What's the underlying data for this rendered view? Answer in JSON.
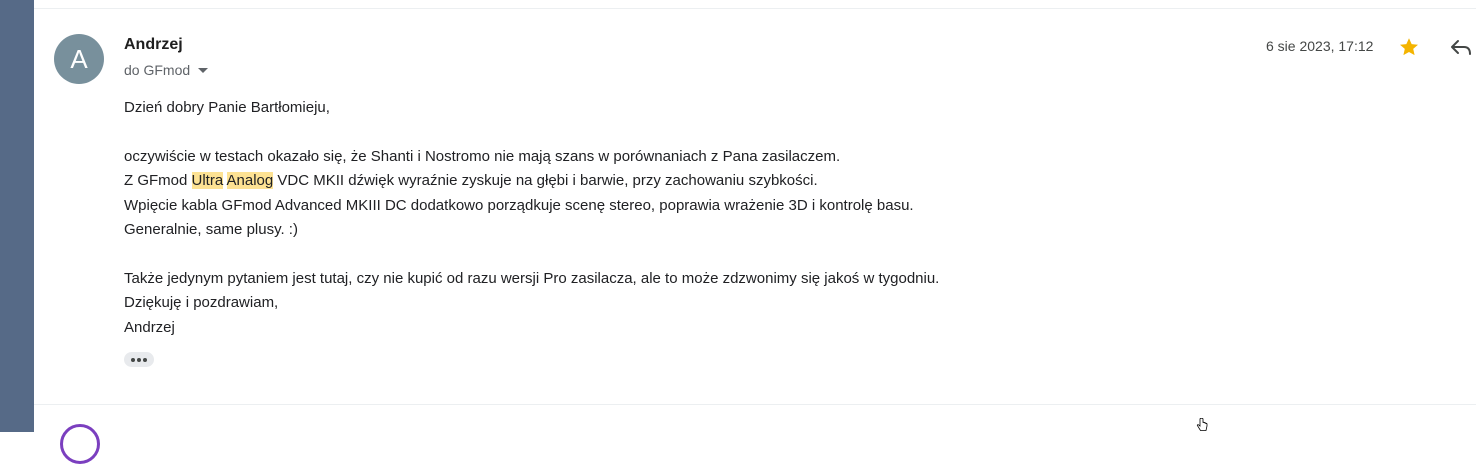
{
  "sender": {
    "avatar_letter": "A",
    "name": "Andrzej",
    "recipient": "do GFmod"
  },
  "meta": {
    "date": "6 sie 2023, 17:12"
  },
  "body": {
    "greeting": "Dzień dobry Panie Bartłomieju,",
    "p1_line1": "oczywiście w testach okazało się, że Shanti i Nostromo nie mają szans w porównaniach z Pana zasilaczem.",
    "p1_line2_pre": "Z GFmod ",
    "p1_line2_hl1": "Ultra",
    "p1_line2_hl2": "Analog",
    "p1_line2_post": " VDC MKII dźwięk wyraźnie zyskuje na głębi i barwie, przy zachowaniu szybkości.",
    "p1_line3": "Wpięcie kabla GFmod Advanced MKIII DC dodatkowo porządkuje scenę stereo, poprawia wrażenie 3D i kontrolę basu.",
    "p1_line4": "Generalnie, same plusy. :)",
    "p2_line1": "Także jedynym pytaniem jest tutaj, czy nie kupić od razu wersji Pro zasilacza, ale to może zdzwonimy się jakoś w tygodniu.",
    "p2_line2": "Dziękuję i pozdrawiam,",
    "signature": "Andrzej"
  },
  "icons": {
    "star": "star-icon",
    "reply": "reply-icon",
    "more": "more-horiz-icon",
    "caret": "caret-down-icon"
  },
  "colors": {
    "rail": "#566a87",
    "avatar": "#78909c",
    "star": "#f4b400",
    "highlight": "#fde293"
  }
}
